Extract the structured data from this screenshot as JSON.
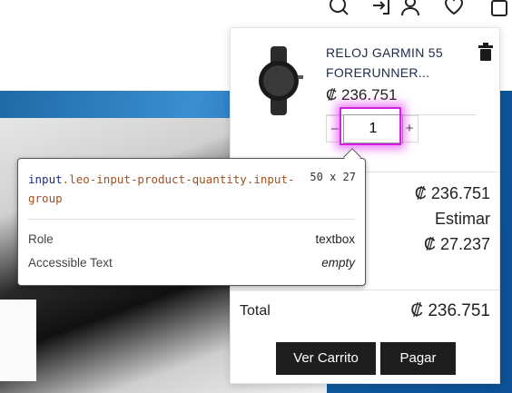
{
  "header": {
    "icons": [
      "search-icon",
      "login-icon",
      "user-icon",
      "heart-icon",
      "bag-icon"
    ]
  },
  "cart": {
    "product_name": "RELOJ GARMIN 55 FORERUNNER...",
    "product_price": "₡ 236.751",
    "quantity": "1",
    "minus_label": "–",
    "plus_label": "+",
    "subtotal": "₡ 236.751",
    "shipping_label": "Estimar",
    "taxes": "₡ 27.237",
    "total_label": "Total",
    "total_value": "₡ 236.751",
    "view_cart_label": "Ver Carrito",
    "pay_label": "Pagar"
  },
  "tooltip": {
    "tag": "input",
    "classes": ".leo-input-product-quantity.input-group",
    "dims": "50 x 27",
    "role_label": "Role",
    "role_value": "textbox",
    "access_label": "Accessible Text",
    "access_value": "empty"
  },
  "colors": {
    "highlight": "#d020e0",
    "button_bg": "#1e1e1e",
    "banner_blue": "#1f6aa8"
  }
}
